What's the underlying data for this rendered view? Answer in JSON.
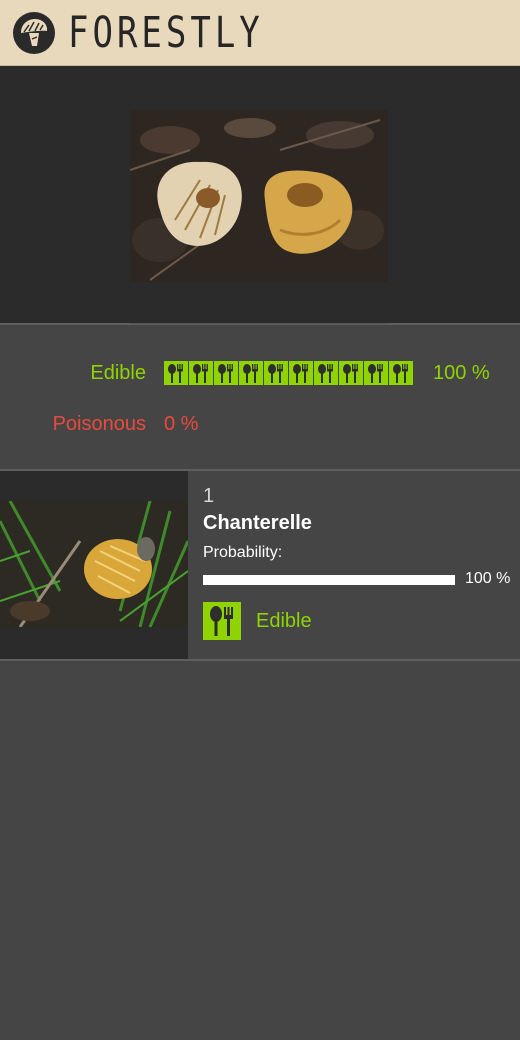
{
  "app": {
    "brand": "FORESTLY",
    "logo_icon": "mushroom-logo-icon"
  },
  "summary": {
    "edible_label": "Edible",
    "edible_percent": "100 %",
    "edible_icon_count": 10,
    "poisonous_label": "Poisonous",
    "poisonous_percent": "0 %"
  },
  "results": [
    {
      "rank": "1",
      "name": "Chanterelle",
      "probability_label": "Probability:",
      "probability": 1.0,
      "probability_text": "100 %",
      "edibility": "Edible"
    }
  ],
  "colors": {
    "edible": "#8fd400",
    "poisonous": "#ea4a3c",
    "header_bg": "#e8d9bc",
    "panel_bg": "#454545",
    "dark_bg": "#2b2b2b"
  }
}
